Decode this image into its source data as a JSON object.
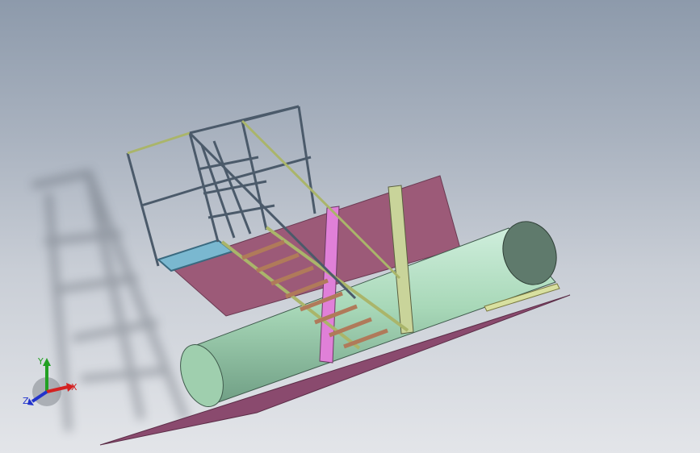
{
  "viewport": {
    "kind": "3d-cad-view",
    "background_top": "#8d9aab",
    "background_bottom": "#e3e5e9"
  },
  "model": {
    "parts": [
      "base-plate",
      "back-panel",
      "cylinder-tank",
      "stair-platform",
      "handrail-frame",
      "support-column",
      "shadow"
    ],
    "colors": {
      "plate": "#8a4a6e",
      "panel": "#9c5a78",
      "tank": "#a8d8b8",
      "tank_cap": "#5f7a6c",
      "frame": "#4b5a6a",
      "frame_green": "#aab56a",
      "frame_pink": "#e080d8",
      "floor_blue": "#7ab8d0"
    }
  },
  "triad": {
    "x_label": "X",
    "y_label": "Y",
    "z_label": "Z",
    "x_color": "#d42222",
    "y_color": "#22a022",
    "z_color": "#2233cc"
  }
}
